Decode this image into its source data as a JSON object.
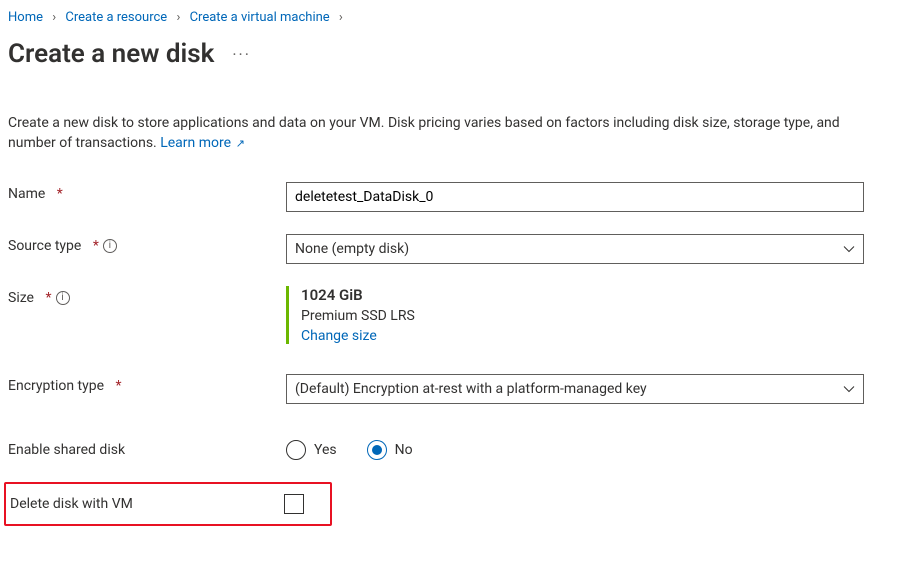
{
  "breadcrumb": {
    "items": [
      "Home",
      "Create a resource",
      "Create a virtual machine"
    ]
  },
  "page": {
    "title": "Create a new disk",
    "ellipsis": "···",
    "description_pre": "Create a new disk to store applications and data on your VM. Disk pricing varies based on factors including disk size, storage type, and number of transactions. ",
    "learn_more": "Learn more"
  },
  "fields": {
    "name": {
      "label": "Name",
      "value": "deletetest_DataDisk_0"
    },
    "source_type": {
      "label": "Source type",
      "value": "None (empty disk)"
    },
    "size": {
      "label": "Size",
      "value": "1024 GiB",
      "tier": "Premium SSD LRS",
      "change_link": "Change size"
    },
    "encryption_type": {
      "label": "Encryption type",
      "value": "(Default) Encryption at-rest with a platform-managed key"
    },
    "enable_shared_disk": {
      "label": "Enable shared disk",
      "yes": "Yes",
      "no": "No",
      "selected": "no"
    },
    "delete_with_vm": {
      "label": "Delete disk with VM",
      "checked": false
    }
  }
}
